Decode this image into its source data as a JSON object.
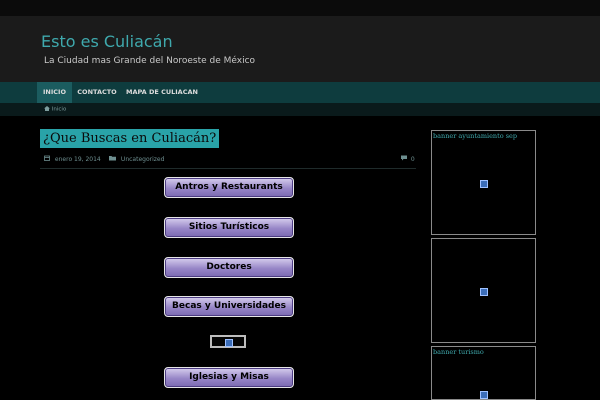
{
  "site": {
    "title": "Esto es Culiacán",
    "description": "La Ciudad mas Grande del Noroeste de México"
  },
  "nav": {
    "items": [
      {
        "label": "INICIO"
      },
      {
        "label": "CONTACTO"
      },
      {
        "label": "MAPA DE CULIACAN"
      }
    ]
  },
  "breadcrumb": {
    "label": "Inicio"
  },
  "post": {
    "title": "¿Que Buscas en Culiacán?",
    "date": "enero 19, 2014",
    "category": "Uncategorized",
    "comments": "0"
  },
  "buttons": [
    {
      "label": "Antros y Restaurants"
    },
    {
      "label": "Sitios Turísticos"
    },
    {
      "label": "Doctores"
    },
    {
      "label": "Becas y Universidades"
    },
    {
      "label": "Iglesias y Misas"
    }
  ],
  "sidebar": {
    "banners": [
      {
        "label": "banner ayuntamiento sep"
      },
      {
        "label": ""
      },
      {
        "label": "banner turismo"
      }
    ]
  },
  "icons": {
    "date": "calendar-icon",
    "category": "folder-icon",
    "comments": "comment-icon",
    "breadcrumb": "home-icon",
    "image_placeholder": "broken-image-icon"
  },
  "colors": {
    "accent": "#3fa9ad",
    "nav_bg": "#0e3c3e",
    "button_fill": "#9786c7"
  }
}
